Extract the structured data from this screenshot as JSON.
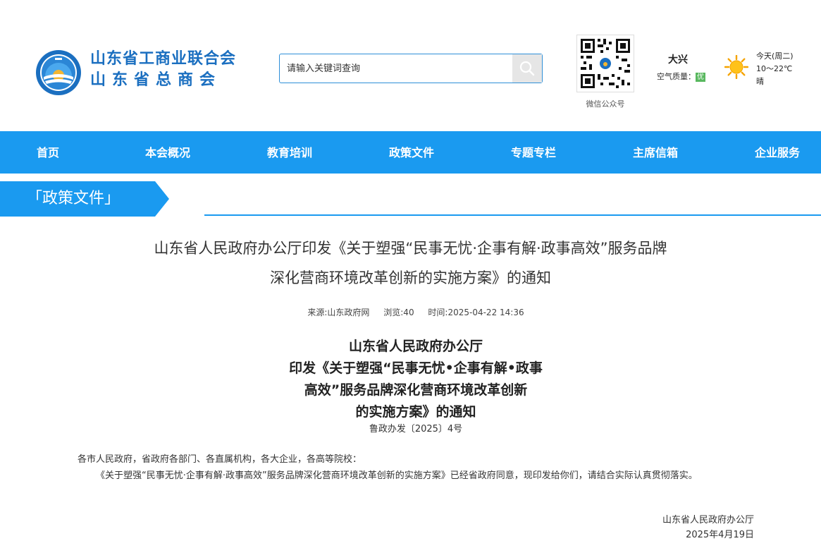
{
  "header": {
    "org_name_line1": "山东省工商业联合会",
    "org_name_line2": "山东省总商会",
    "search_placeholder": "请输入关键词查询",
    "search_icon": "search-icon",
    "qr_label": "微信公众号",
    "weather": {
      "city": "大兴",
      "aqi_label": "空气质量：",
      "aqi_value": "优",
      "day": "今天(周二)",
      "temp": "10～22℃",
      "condition": "晴",
      "icon": "sun-icon"
    }
  },
  "nav": {
    "items": [
      {
        "label": "首页"
      },
      {
        "label": "本会概况"
      },
      {
        "label": "教育培训"
      },
      {
        "label": "政策文件"
      },
      {
        "label": "专题专栏"
      },
      {
        "label": "主席信箱"
      },
      {
        "label": "企业服务"
      }
    ]
  },
  "section": {
    "label": "「政策文件」"
  },
  "article": {
    "title_line1": "山东省人民政府办公厅印发《关于塑强“民事无忧·企事有解·政事高效”服务品牌",
    "title_line2": "深化营商环境改革创新的实施方案》的通知",
    "source": "来源:山东政府网",
    "views": "浏览:40",
    "time": "时间:2025-04-22 14:36",
    "doc_title_lines": [
      "山东省人民政府办公厅",
      "印发《关于塑强“民事无忧•企事有解•政事",
      "高效”服务品牌深化营商环境改革创新",
      "的实施方案》的通知"
    ],
    "doc_number": "鲁政办发〔2025〕4号",
    "salutation": "各市人民政府，省政府各部门、各直属机构，各大企业，各高等院校：",
    "paragraph": "《关于塑强“民事无忧·企事有解·政事高效”服务品牌深化营商环境改革创新的实施方案》已经省政府同意，现印发给你们，请结合实际认真贯彻落实。",
    "signer": "山东省人民政府办公厅",
    "sign_date": "2025年4月19日"
  },
  "colors": {
    "primary_blue": "#1a9af0",
    "logo_blue": "#1b6fc0",
    "aqi_green": "#59b85f"
  }
}
